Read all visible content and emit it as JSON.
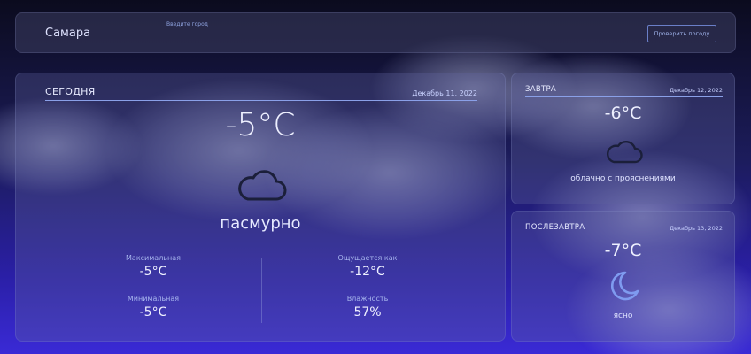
{
  "header": {
    "city": "Самара",
    "search_label": "Введите город",
    "search_value": "",
    "check_button": "Проверить погоду"
  },
  "today": {
    "title": "СЕГОДНЯ",
    "date": "Декабрь 11, 2022",
    "temperature": "-5°C",
    "icon": "cloud-icon",
    "description": "пасмурно",
    "stats": {
      "max_label": "Максимальная",
      "max_value": "-5°C",
      "min_label": "Минимальная",
      "min_value": "-5°C",
      "feels_label": "Ощущается как",
      "feels_value": "-12°C",
      "humidity_label": "Влажность",
      "humidity_value": "57%"
    }
  },
  "tomorrow": {
    "title": "ЗАВТРА",
    "date": "Декабрь 12, 2022",
    "temperature": "-6°C",
    "icon": "cloud-icon",
    "description": "облачно с прояснениями"
  },
  "day_after": {
    "title": "ПОСЛЕЗАВТРА",
    "date": "Декабрь 13, 2022",
    "temperature": "-7°C",
    "icon": "moon-icon",
    "description": "ясно"
  },
  "colors": {
    "accent": "#6f86d6",
    "moon": "#7f9bf0",
    "background_top": "#0b0b1e",
    "background_bottom": "#3a2ad6"
  }
}
